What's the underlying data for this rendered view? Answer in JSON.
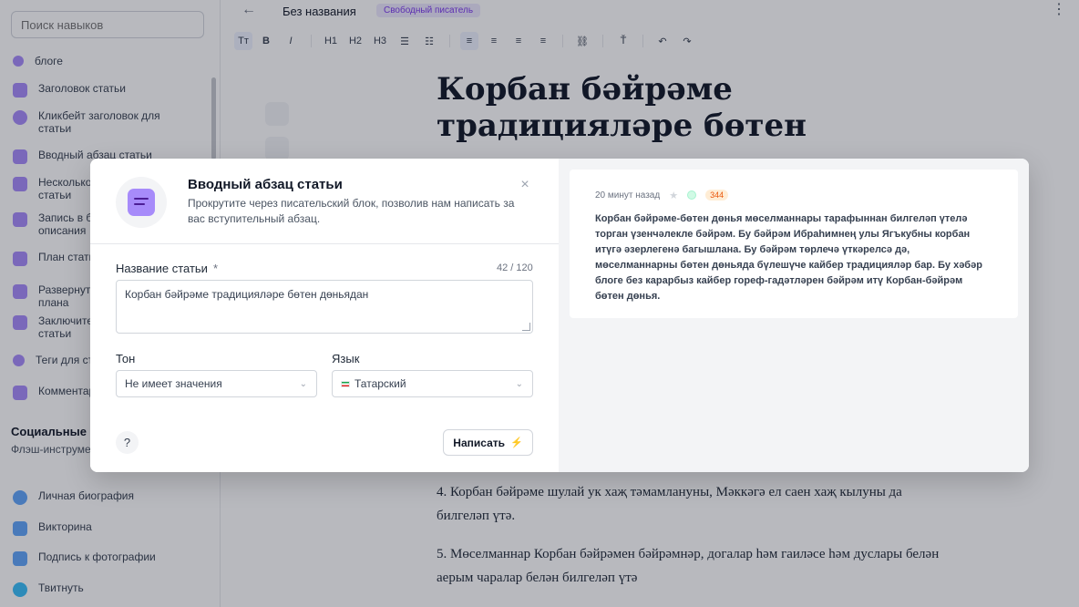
{
  "sidebar": {
    "search_placeholder": "Поиск навыков",
    "items": [
      {
        "label": "блоге",
        "color": "#8b5cf6"
      },
      {
        "label": "Заголовок статьи",
        "color": "#8b5cf6"
      },
      {
        "label": "Кликбейт заголовок для статьи",
        "color": "#8b5cf6"
      },
      {
        "label": "Вводный абзац статьи",
        "color": "#8b5cf6"
      },
      {
        "label": "Несколько статьи",
        "color": "#8b5cf6"
      },
      {
        "label": "Запись в б описания",
        "color": "#8b5cf6"
      },
      {
        "label": "План стать",
        "color": "#8b5cf6"
      },
      {
        "label": "Развернут плана",
        "color": "#8b5cf6"
      },
      {
        "label": "Заключите статьи",
        "color": "#8b5cf6"
      },
      {
        "label": "Теги для ст",
        "color": "#8b5cf6"
      },
      {
        "label": "Комментар",
        "color": "#8b5cf6"
      }
    ],
    "section_title": "Социальные с",
    "section_desc": "Флэш-инструме социальных сет",
    "social_items": [
      {
        "label": "Личная биография",
        "color": "#60a5fa"
      },
      {
        "label": "Викторина",
        "color": "#60a5fa"
      },
      {
        "label": "Подпись к фотографии",
        "color": "#60a5fa"
      },
      {
        "label": "Твитнуть",
        "color": "#38bdf8"
      }
    ]
  },
  "topbar": {
    "back_icon": "←",
    "doc_title": "Без названия",
    "plan_badge": "Свободный писатель",
    "more_icon": "⋮"
  },
  "toolbar": {
    "text_size": "Tт",
    "bold": "B",
    "italic": "I",
    "h1": "H1",
    "h2": "H2",
    "h3": "H3",
    "bullet_list": "☰",
    "numbered_list": "☷",
    "align_left": "≡",
    "align_center": "≡",
    "align_right": "≡",
    "align_justify": "≡",
    "link": "⛓",
    "clear_format": "Ť",
    "undo": "↶",
    "redo": "↷"
  },
  "article": {
    "title": "Корбан бәйрәме традицияләре бөтен",
    "para4": "4. Корбан бәйрәме шулай ук хаҗ тәмамлануны, Мәккәгә ел саен хаҗ кылуны да билгеләп үтә.",
    "para5": "5. Мөселманнар Корбан бәйрәмен бәйрәмнәр, догалар һәм гаиләсе һәм дуслары белән аерым чаралар белән билгеләп үтә"
  },
  "modal": {
    "title": "Вводный абзац статьи",
    "description": "Прокрутите через писательский блок, позволив нам написать за вас вступительный абзац.",
    "close_icon": "×",
    "article_name_label": "Название статьи",
    "required_mark": "*",
    "char_counter": "42 / 120",
    "article_name_value": "Корбан бәйрәме традицияләре бөтен дөньядан",
    "tone_label": "Тон",
    "tone_value": "Не имеет значения",
    "language_label": "Язык",
    "language_value": "Татарский",
    "chevron_icon": "⌄",
    "help_label": "?",
    "write_button": "Написать",
    "bolt_icon": "⚡"
  },
  "result": {
    "time": "20 минут назад",
    "star_icon": "★",
    "word_count": "344",
    "text": "Корбан бәйрәме-бөтен дөнья мөселманнары тарафыннан билгеләп үтелә торган үзенчәлекле бәйрәм. Бу бәйрәм Ибраһимнең улы Ягъкубны корбан итүгә әзерлегенә багышлана. Бу бәйрәм төрлечә үткәрелсә дә, мөселманнарны бөтен дөньяда бүлешүче кайбер традицияләр бар. Бу хәбәр блоге без карарбыз кайбер гореф-гадәтләрен бәйрәм итү Корбан-бәйрәм бөтен дөнья."
  },
  "colors": {
    "accent": "#8b5cf6",
    "badge_bg": "#ede9fe",
    "counter_badge": "#ea580c"
  }
}
